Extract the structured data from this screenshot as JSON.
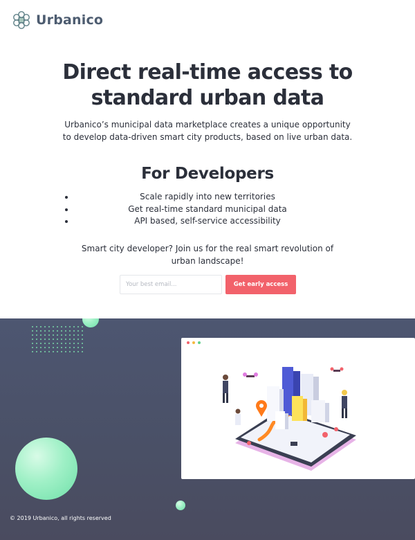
{
  "header": {
    "brand": "Urbanico",
    "logo_icon": "hexagon-network-logo-icon"
  },
  "hero": {
    "headline": "Direct real-time access to standard urban data",
    "subtitle": "Urbanico’s municipal data marketplace creates a unique opportunity to develop data-driven smart city products, based on live urban data."
  },
  "developers": {
    "title": "For Developers",
    "bullets": [
      "Scale rapidly into new territories",
      "Get real-time standard municipal data",
      "API based, self-service accessibility"
    ],
    "cta_text": "Smart city developer? Join us for the real smart revolution of urban landscape!"
  },
  "signup": {
    "email_placeholder": "Your best email...",
    "button_label": "Get early access"
  },
  "footer": {
    "copyright": "© 2019 Urbanico, all rights reserved"
  },
  "colors": {
    "accent": "#f2626b",
    "brand_text": "#4d5c70",
    "footer_bg": "#4d5671",
    "bubble": "#9ff0c6",
    "text": "#2b2f3a"
  }
}
